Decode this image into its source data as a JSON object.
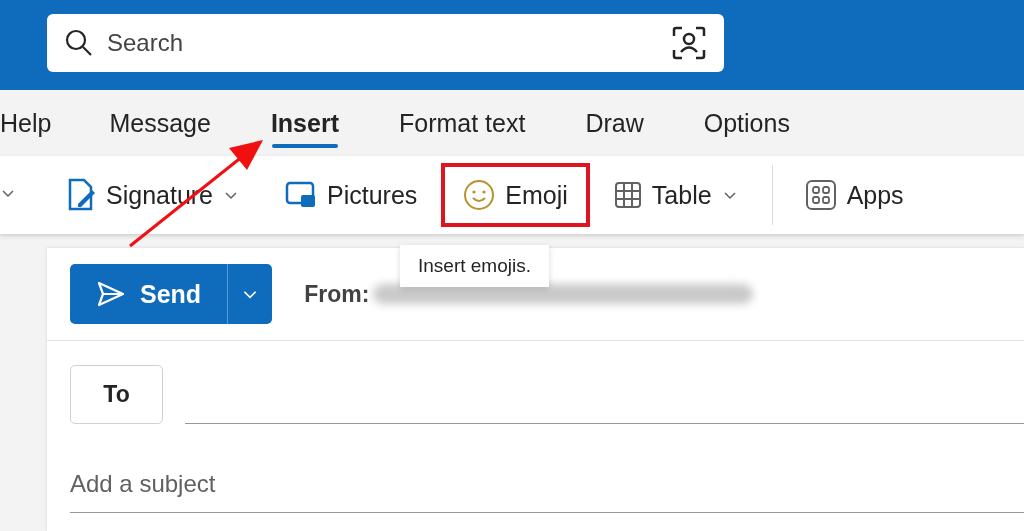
{
  "search": {
    "placeholder": "Search"
  },
  "tabs": [
    {
      "label": "Help",
      "selected": false
    },
    {
      "label": "Message",
      "selected": false
    },
    {
      "label": "Insert",
      "selected": true
    },
    {
      "label": "Format text",
      "selected": false
    },
    {
      "label": "Draw",
      "selected": false
    },
    {
      "label": "Options",
      "selected": false
    }
  ],
  "toolbar": [
    {
      "kind": "caret"
    },
    {
      "kind": "signature",
      "label": "Signature",
      "dropdown": true,
      "highlighted": false
    },
    {
      "kind": "pictures",
      "label": "Pictures",
      "dropdown": false,
      "highlighted": false
    },
    {
      "kind": "emoji",
      "label": "Emoji",
      "dropdown": false,
      "highlighted": true
    },
    {
      "kind": "table",
      "label": "Table",
      "dropdown": true,
      "highlighted": false
    },
    {
      "kind": "divider"
    },
    {
      "kind": "apps",
      "label": "Apps",
      "dropdown": false,
      "highlighted": false
    }
  ],
  "tooltip": "Insert emojis.",
  "compose": {
    "send": "Send",
    "from_label": "From:",
    "to": "To",
    "subject_placeholder": "Add a subject"
  }
}
